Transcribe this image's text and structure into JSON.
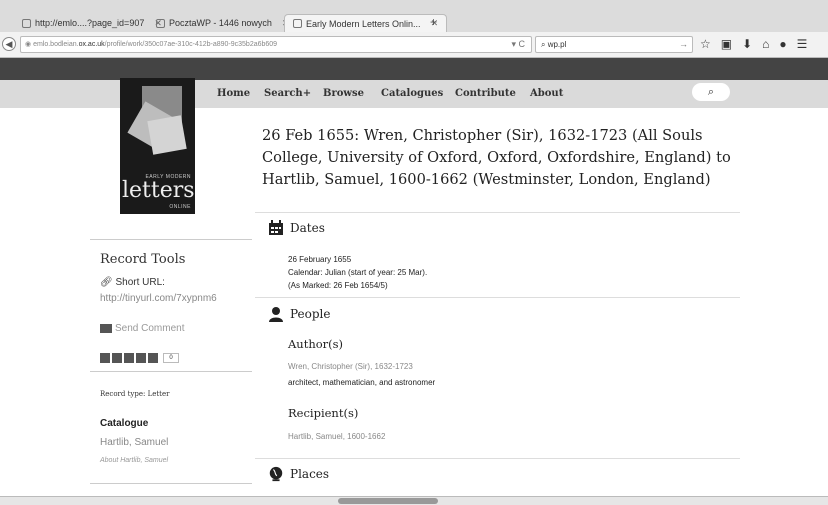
{
  "browser": {
    "tabs": [
      {
        "label": "http://emlo....?page_id=907"
      },
      {
        "label": "PocztaWP - 1446 nowych"
      },
      {
        "label": "Early Modern Letters Onlin..."
      }
    ],
    "new_tab": "+",
    "url_prefix": "emlo.bodleian.",
    "url_domain": "ox.ac.uk",
    "url_path": "/profile/work/350c07ae-310c-412b-a890-9c35b2a6b609",
    "search_value": "wp.pl",
    "toolbar_icons": [
      "star-icon",
      "clipboard-icon",
      "download-icon",
      "home-icon",
      "chat-icon",
      "menu-icon"
    ]
  },
  "site_nav": {
    "items": [
      "Home",
      "Search+",
      "Browse",
      "Catalogues",
      "Contribute",
      "About"
    ],
    "search_glyph": "⌕"
  },
  "logo": {
    "line1": "EARLY MODERN",
    "line2": "letters",
    "line3": "ONLINE"
  },
  "sidebar": {
    "record_tools": "Record Tools",
    "short_url_label": "Short URL:",
    "short_url": "http://tinyurl.com/7xypnm6",
    "send_comment": "Send Comment",
    "share_count": "0",
    "record_type": "Record type: Letter",
    "catalogue_title": "Catalogue",
    "catalogue_value": "Hartlib, Samuel",
    "catalogue_about": "About Hartlib, Samuel"
  },
  "main": {
    "title": "26 Feb 1655: Wren, Christopher (Sir), 1632-1723 (All Souls College, University of Oxford, Oxford, Oxfordshire, England) to Hartlib, Samuel, 1600-1662 (Westminster, London, England)",
    "dates": {
      "heading": "Dates",
      "line1": "26 February 1655",
      "line2": "Calendar: Julian (start of year: 25 Mar).",
      "line3": "(As Marked: 26 Feb 1654/5)"
    },
    "people": {
      "heading": "People",
      "authors_heading": "Author(s)",
      "author_name": "Wren, Christopher (Sir), 1632-1723",
      "author_desc": "architect, mathematician, and astronomer",
      "recipients_heading": "Recipient(s)",
      "recipient_name": "Hartlib, Samuel, 1600-1662"
    },
    "places": {
      "heading": "Places"
    }
  }
}
